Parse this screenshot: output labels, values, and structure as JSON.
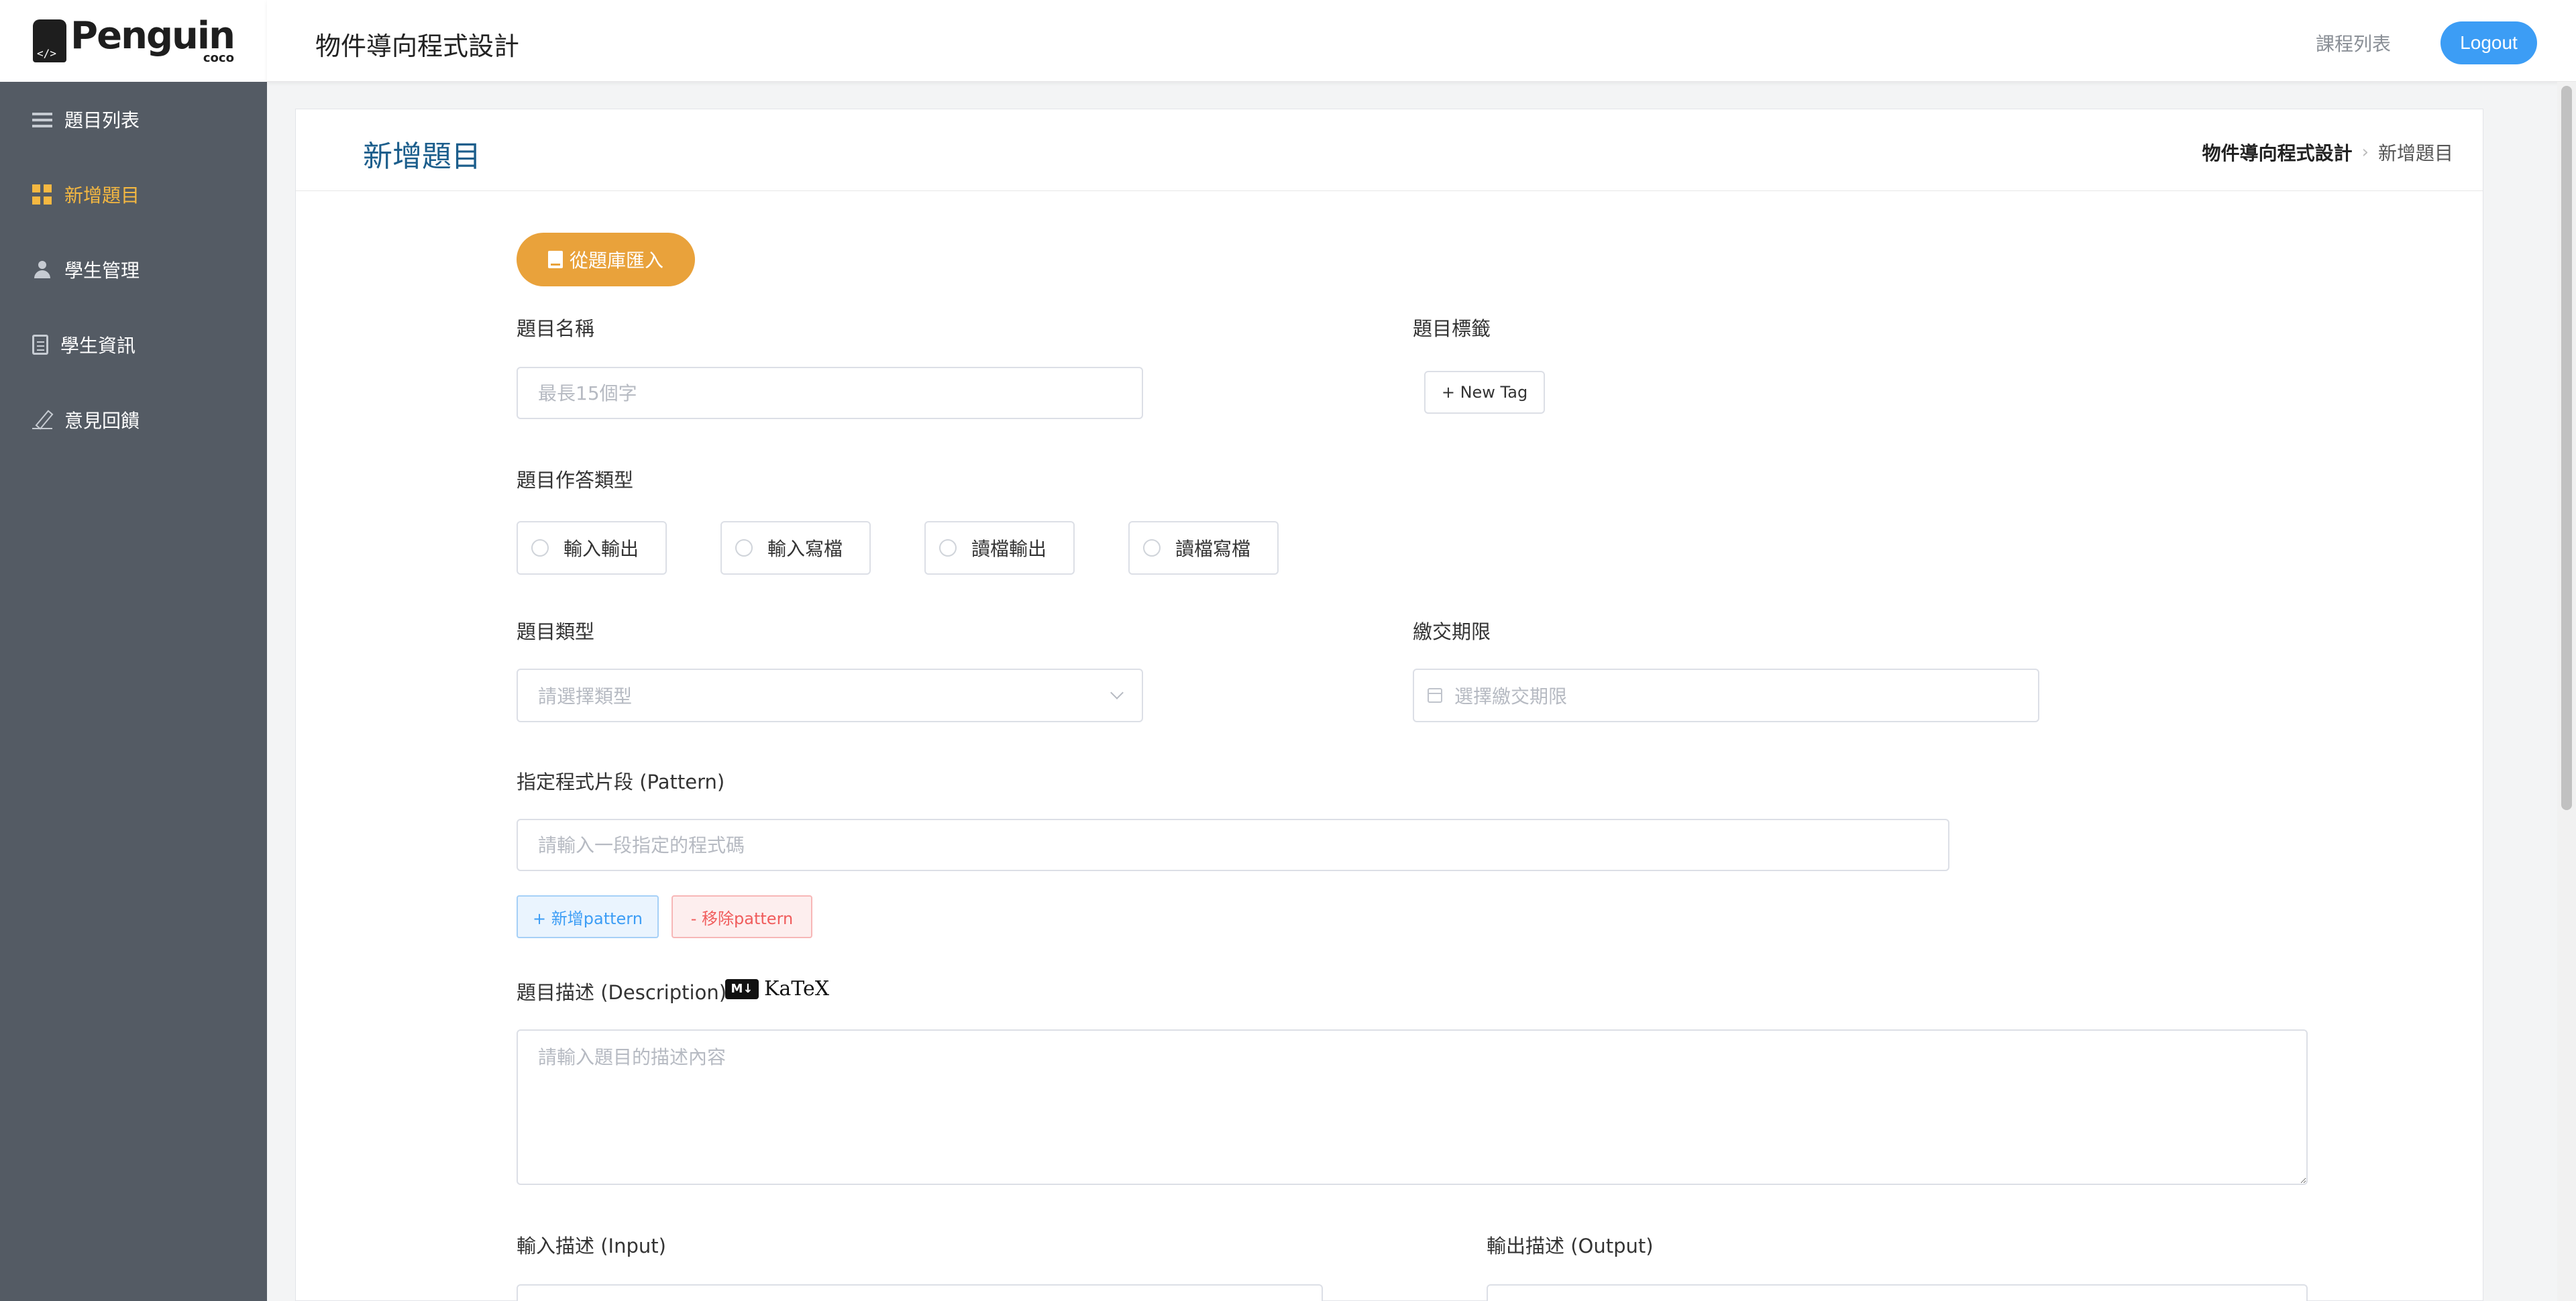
{
  "brand": {
    "title": "Penguin",
    "subtitle": "coco"
  },
  "sidebar": {
    "items": [
      {
        "label": "題目列表",
        "icon": "list-icon",
        "active": false
      },
      {
        "label": "新增題目",
        "icon": "grid-icon",
        "active": true
      },
      {
        "label": "學生管理",
        "icon": "user-icon",
        "active": false
      },
      {
        "label": "學生資訊",
        "icon": "document-icon",
        "active": false
      },
      {
        "label": "意見回饋",
        "icon": "edit-icon",
        "active": false
      }
    ]
  },
  "header": {
    "title": "物件導向程式設計",
    "course_list_link": "課程列表",
    "logout_label": "Logout"
  },
  "page": {
    "title": "新增題目",
    "breadcrumb": [
      "物件導向程式設計",
      "新增題目"
    ]
  },
  "form": {
    "import_button": "從題庫匯入",
    "name": {
      "label": "題目名稱",
      "placeholder": "最長15個字",
      "value": ""
    },
    "tags": {
      "label": "題目標籤",
      "new_tag": "+ New Tag"
    },
    "answer_type": {
      "label": "題目作答類型",
      "options": [
        "輸入輸出",
        "輸入寫檔",
        "讀檔輸出",
        "讀檔寫檔"
      ],
      "selected": null
    },
    "type": {
      "label": "題目類型",
      "placeholder": "請選擇類型"
    },
    "deadline": {
      "label": "繳交期限",
      "placeholder": "選擇繳交期限"
    },
    "pattern": {
      "label": "指定程式片段 (Pattern)",
      "placeholder": "請輸入一段指定的程式碼",
      "add_button": "+ 新增pattern",
      "remove_button": "- 移除pattern"
    },
    "description": {
      "label": "題目描述 (Description)",
      "placeholder": "請輸入題目的描述內容",
      "markdown_badge": "M↓",
      "katex_badge": "KaTeX"
    },
    "input_desc": {
      "label": "輸入描述 (Input)"
    },
    "output_desc": {
      "label": "輸出描述 (Output)"
    }
  },
  "colors": {
    "sidebar_bg": "#545b64",
    "active_menu": "#f5b841",
    "primary": "#3c9df5",
    "import_button": "#e9a23b",
    "title_blue": "#1c5e8c",
    "danger": "#f05c5c"
  }
}
